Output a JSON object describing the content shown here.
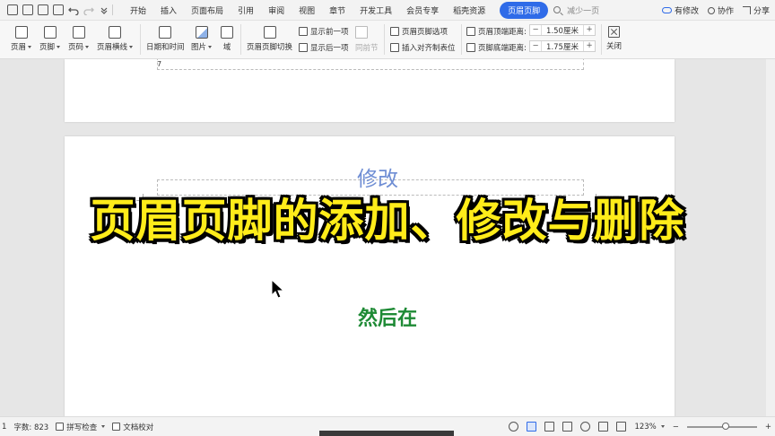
{
  "menubar": {
    "tabs": [
      "开始",
      "插入",
      "页面布局",
      "引用",
      "审阅",
      "视图",
      "章节",
      "开发工具",
      "会员专享",
      "稻壳资源"
    ],
    "active_tab": "页眉页脚",
    "search_placeholder": "减少一页",
    "right": {
      "changes": "有修改",
      "collab": "协作",
      "share": "分享"
    }
  },
  "ribbon": {
    "header_btn": "页眉",
    "footer_btn": "页脚",
    "page_number_btn": "页码",
    "header_line_btn": "页眉横线",
    "datetime_btn": "日期和时间",
    "picture_btn": "图片",
    "field_btn": "域",
    "switch_btn": "页眉页脚切换",
    "show_prev": "显示前一项",
    "show_next": "显示后一项",
    "same_as_prev": "同前节",
    "hf_options": "页眉页脚选项",
    "insert_align_tab": "插入对齐制表位",
    "header_top_label": "页眉顶端距离:",
    "header_top_value": "1.50厘米",
    "footer_bottom_label": "页脚底端距离:",
    "footer_bottom_value": "1.75厘米",
    "close_btn": "关闭"
  },
  "document": {
    "page_number": "7",
    "typed_text": "修改",
    "subtitle": "然后在"
  },
  "overlay": {
    "title": "页眉页脚的添加、修改与删除"
  },
  "statusbar": {
    "word_count": "字数: 823",
    "spell_check": "拼写检查",
    "doc_proof": "文档校对",
    "zoom": "123%",
    "zoom_level": 0.55
  },
  "colors": {
    "accent": "#2f6be8",
    "title_yellow": "#ffec1a",
    "subtitle_green": "#1e8a35"
  }
}
